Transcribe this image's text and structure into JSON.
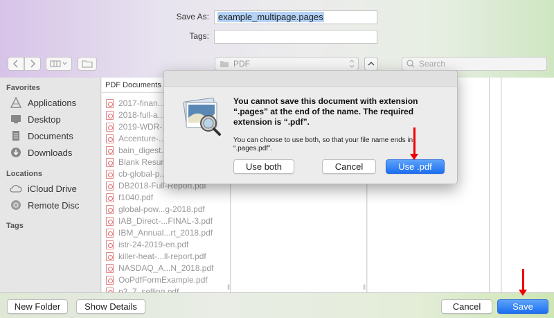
{
  "save_as": {
    "label": "Save As:",
    "value": "example_multipage.pages"
  },
  "tags": {
    "label": "Tags:",
    "value": ""
  },
  "toolbar": {
    "back_icon": "chevron-left-icon",
    "forward_icon": "chevron-right-icon",
    "view_icon": "column-view-icon",
    "new_folder_icon": "folder-icon",
    "location": "PDF",
    "search_placeholder": "Search"
  },
  "sidebar": {
    "favorites_heading": "Favorites",
    "favorites": [
      {
        "label": "Applications",
        "icon": "applications-icon"
      },
      {
        "label": "Desktop",
        "icon": "desktop-icon"
      },
      {
        "label": "Documents",
        "icon": "documents-icon"
      },
      {
        "label": "Downloads",
        "icon": "downloads-icon"
      }
    ],
    "locations_heading": "Locations",
    "locations": [
      {
        "label": "iCloud Drive",
        "icon": "cloud-icon"
      },
      {
        "label": "Remote Disc",
        "icon": "disc-icon"
      }
    ],
    "tags_heading": "Tags"
  },
  "column1": {
    "header": "PDF Documents",
    "files": [
      "2017-finan...",
      "2018-full-a...",
      "2019-WDR-...",
      "Accenture-...",
      "bain_digest...",
      "Blank Resum...",
      "cb-global-p...",
      "DB2018-Full-Report.pdf",
      "f1040.pdf",
      "global-pow...g-2018.pdf",
      "IAB_Direct-...FINAL-3.pdf",
      "IBM_Annual...rt_2018.pdf",
      "istr-24-2019-en.pdf",
      "killer-heat-...ll-report.pdf",
      "NASDAQ_A...N_2018.pdf",
      "OoPdfFormExample.pdf",
      "p2_7_selling.pdf"
    ]
  },
  "alert": {
    "title": "You cannot save this document with extension “.pages” at the end of the name. The required extension is “.pdf”.",
    "message": "You can choose to use both, so that your file name ends in “.pages.pdf”.",
    "use_both": "Use both",
    "cancel": "Cancel",
    "use_pdf": "Use .pdf",
    "icon": "preview-app-icon"
  },
  "footer": {
    "new_folder": "New Folder",
    "show_details": "Show Details",
    "cancel": "Cancel",
    "save": "Save"
  },
  "colors": {
    "accent": "#1d6ff2",
    "annotation_arrow": "#e00000",
    "pdf_icon": "#e06666"
  }
}
